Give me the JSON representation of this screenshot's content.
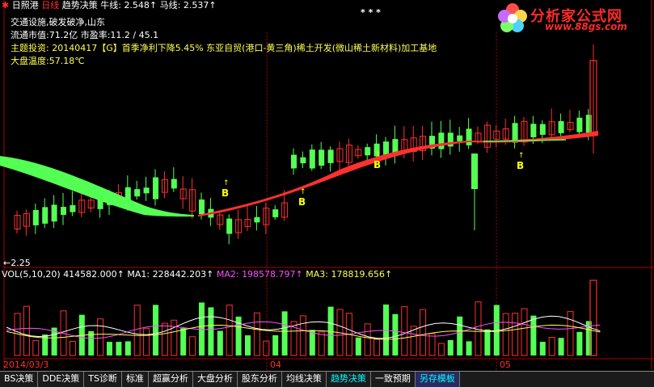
{
  "header": {
    "stock_name": "日照港",
    "period": "日线",
    "indicator": "趋势决策",
    "niu_label": "牛线:",
    "niu_value": "2.548↑",
    "ma_label": "马线:",
    "ma_value": "2.537↑",
    "stars": "* * *",
    "info_line1": "交通设施,破发破净,山东",
    "info_line2": "流通市值:71.2亿  市盈率:11.2 / 45.1",
    "theme_label": "主题投资:",
    "theme_text": "20140417【G】首季净利下降5.45% 东亚自贸(港口-黄三角)稀土开发(微山稀土新材料)加工基地",
    "temperature": "大盘温度:57.18℃"
  },
  "logo": {
    "title": "分析家公式网",
    "url": "www.88gs.com"
  },
  "main_chart": {
    "price_low_label": "←2.25",
    "buy_signal_label": "B",
    "up_color": "#ff3030",
    "down_color": "#54ff54"
  },
  "volume": {
    "label": "VOL(5,10,20)",
    "vol_value": "414582.000↑",
    "ma1_label": "MA1:",
    "ma1_value": "228442.203↑",
    "ma2_label": "MA2:",
    "ma2_value": "198578.797↑",
    "ma3_label": "MA3:",
    "ma3_value": "178819.656↑",
    "ma1_color": "#ffffff",
    "ma2_color": "#ff4dff",
    "ma3_color": "#ffff55"
  },
  "date_axis": {
    "start": "2014/03/3",
    "month_04": "04",
    "month_05": "05"
  },
  "tabs": [
    {
      "label": "BS决策",
      "state": "normal"
    },
    {
      "label": "DDE决策",
      "state": "normal"
    },
    {
      "label": "TS诊断",
      "state": "normal"
    },
    {
      "label": "标准",
      "state": "normal"
    },
    {
      "label": "超赢分析",
      "state": "normal"
    },
    {
      "label": "大盘分析",
      "state": "normal"
    },
    {
      "label": "股东分析",
      "state": "normal"
    },
    {
      "label": "均线决策",
      "state": "normal"
    },
    {
      "label": "趋势决策",
      "state": "active"
    },
    {
      "label": "一致预期",
      "state": "normal"
    },
    {
      "label": "另存模板",
      "state": "special"
    }
  ]
}
